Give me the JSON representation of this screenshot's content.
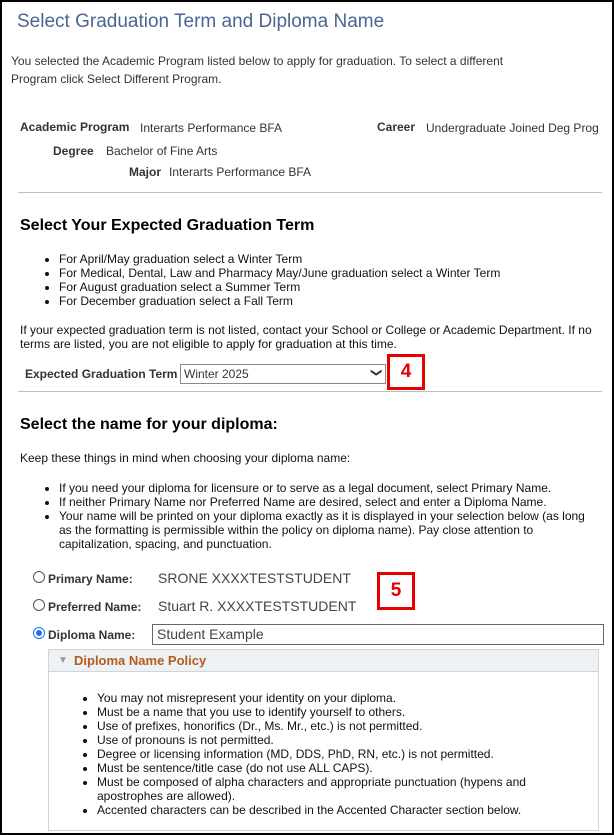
{
  "page": {
    "title": "Select Graduation Term and Diploma Name",
    "intro": "You selected the Academic Program listed below to apply for graduation. To select a different Program click Select Different Program."
  },
  "program": {
    "academic_program_label": "Academic Program",
    "academic_program_value": "Interarts Performance BFA",
    "career_label": "Career",
    "career_value": "Undergraduate Joined Deg Prog",
    "degree_label": "Degree",
    "degree_value": "Bachelor of Fine Arts",
    "major_label": "Major",
    "major_value": "Interarts Performance BFA"
  },
  "term_section": {
    "heading": "Select Your Expected Graduation Term",
    "bullets": [
      "For April/May graduation select a Winter Term",
      "For Medical, Dental, Law and Pharmacy May/June graduation select a Winter Term",
      "For August graduation select a Summer Term",
      "For December graduation select a Fall Term"
    ],
    "note": "If your expected graduation term is not listed, contact your School or College or Academic Department. If no terms are listed, you are not eligible to apply for graduation at this time.",
    "field_label": "Expected Graduation Term",
    "selected_term": "Winter 2025",
    "chevron_icon": "chevron-down-icon"
  },
  "diploma_section": {
    "heading": "Select the name for your diploma:",
    "intro": "Keep these things in mind when choosing your diploma name:",
    "bullets": [
      "If you need your diploma for licensure or to serve as a legal document, select Primary Name.",
      "If neither Primary Name nor Preferred Name are desired, select and enter a Diploma Name.",
      "Your name will be printed on your diploma exactly as it is displayed in your selection below (as long as the formatting is permissible within the policy on diploma name). Pay close attention to capitalization, spacing, and punctuation."
    ],
    "options": [
      {
        "label": "Primary Name:",
        "value": "SRONE XXXXTESTSTUDENT",
        "checked": false
      },
      {
        "label": "Preferred Name:",
        "value": "Stuart R. XXXXTESTSTUDENT",
        "checked": false
      },
      {
        "label": "Diploma Name:",
        "value": "Student Example",
        "checked": true
      }
    ],
    "policy": {
      "title": "Diploma Name Policy",
      "expanded": true,
      "items": [
        "You may not misrepresent your identity on your diploma.",
        "Must be a name that you use to identify yourself to others.",
        "Use of prefixes, honorifics (Dr., Ms. Mr., etc.) is not permitted.",
        "Use of pronouns is not permitted.",
        "Degree or licensing information (MD, DDS, PhD, RN, etc.) is not permitted.",
        "Must be sentence/title case (do not use ALL CAPS).",
        "Must be composed of alpha characters and appropriate punctuation (hypens and apostrophes are allowed).",
        "Accented characters can be described in the Accented Character section below."
      ]
    }
  },
  "callouts": {
    "step4": "4",
    "step5": "5",
    "color": "#e60000"
  }
}
